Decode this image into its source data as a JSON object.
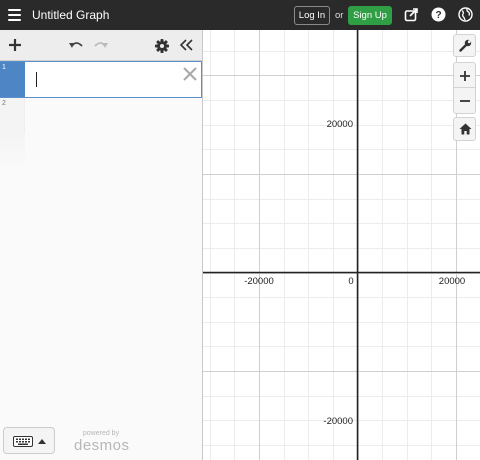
{
  "header": {
    "title": "Untitled Graph",
    "login_label": "Log In",
    "or_label": "or",
    "signup_label": "Sign Up"
  },
  "expressions": [
    {
      "number": "1",
      "value": ""
    },
    {
      "number": "2",
      "value": ""
    }
  ],
  "footer": {
    "powered_by": "powered by",
    "brand": "desmos"
  },
  "graph": {
    "x_ticks": [
      "-20000",
      "0",
      "20000"
    ],
    "y_ticks": [
      "20000",
      "-20000"
    ]
  },
  "colors": {
    "header_bg": "#2a2a2a",
    "signup_green": "#2f9e44",
    "active_tab_blue": "#4d85c5"
  },
  "icons": [
    "menu-icon",
    "share-icon",
    "help-icon",
    "globe-icon",
    "plus-icon",
    "undo-icon",
    "redo-icon",
    "gear-icon",
    "collapse-icon",
    "close-icon",
    "keyboard-icon",
    "wrench-icon",
    "zoom-in-icon",
    "zoom-out-icon",
    "home-icon"
  ]
}
